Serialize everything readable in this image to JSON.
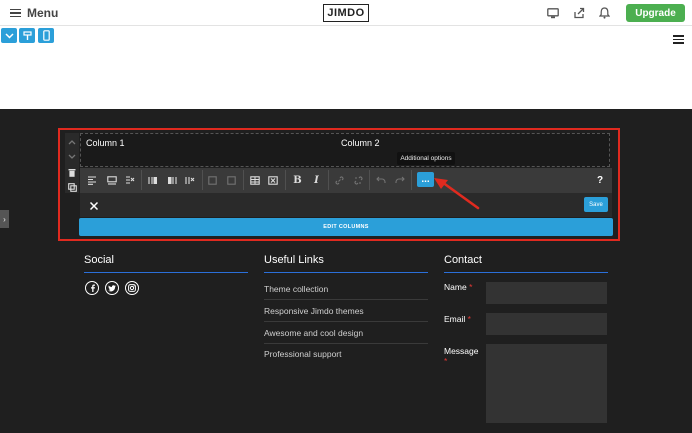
{
  "topbar": {
    "menu_label": "Menu",
    "logo_text": "JIMDO",
    "upgrade_label": "Upgrade",
    "icons": [
      "desktop-icon",
      "share-icon",
      "bell-icon"
    ]
  },
  "device_buttons": [
    "chevron-down-icon",
    "paint-roller-icon",
    "mobile-icon"
  ],
  "editor": {
    "columns": [
      "Column 1",
      "Column 2"
    ],
    "tooltip": "Additional options",
    "more_label": "...",
    "help_label": "?",
    "bold_label": "B",
    "italic_label": "I",
    "save_label": "Save",
    "edit_columns_label": "EDIT COLUMNS"
  },
  "footer": {
    "social": {
      "title": "Social",
      "icons": [
        "facebook-icon",
        "twitter-icon",
        "instagram-icon"
      ]
    },
    "links": {
      "title": "Useful Links",
      "items": [
        "Theme collection",
        "Responsive Jimdo themes",
        "Awesome and cool design",
        "Professional support"
      ]
    },
    "contact": {
      "title": "Contact",
      "fields": [
        {
          "label": "Name",
          "required": "*"
        },
        {
          "label": "Email",
          "required": "*"
        },
        {
          "label": "Message",
          "required": "*"
        }
      ]
    }
  },
  "colors": {
    "accent": "#2b9fd9",
    "upgrade": "#4caf50",
    "highlight": "#e02a1f",
    "footer_bg": "#1f1f1f"
  }
}
